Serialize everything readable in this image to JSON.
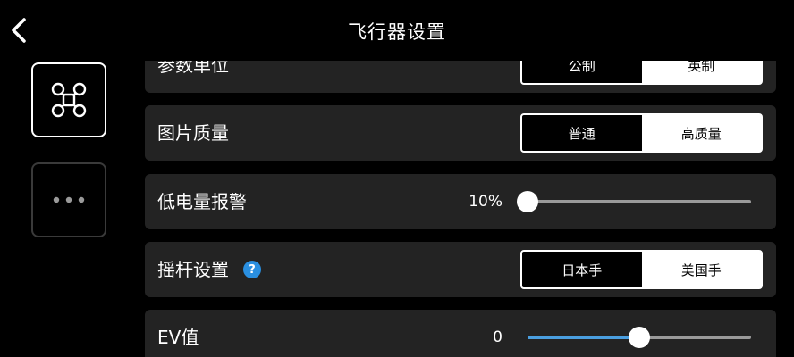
{
  "header": {
    "title": "飞行器设置"
  },
  "icons": {
    "back": "chevron-left-icon",
    "drone": "drone-icon",
    "more": "more-dots-icon",
    "help": "help-icon"
  },
  "colors": {
    "accent": "#4a9fe0",
    "help": "#2a8fe0",
    "row_bg": "#232323",
    "background": "#000000"
  },
  "settings": {
    "units": {
      "label": "参数单位",
      "options": [
        "公制",
        "英制"
      ],
      "selected": "公制"
    },
    "image_quality": {
      "label": "图片质量",
      "options": [
        "普通",
        "高质量"
      ],
      "selected": "普通"
    },
    "low_battery": {
      "label": "低电量报警",
      "value_text": "10%",
      "level": 0
    },
    "stick_mode": {
      "label": "摇杆设置",
      "help_glyph": "?",
      "options": [
        "日本手",
        "美国手"
      ],
      "selected": "日本手"
    },
    "ev": {
      "label": "EV值",
      "value_text": "0",
      "level": 0.5
    }
  }
}
